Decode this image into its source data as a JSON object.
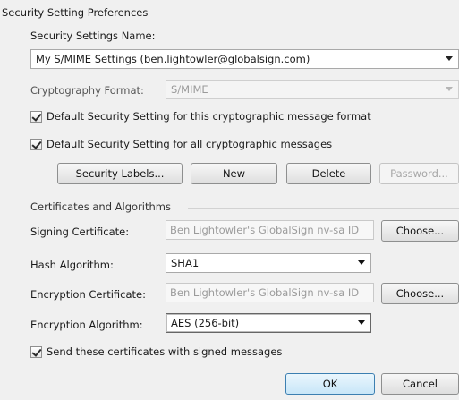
{
  "group_security": {
    "title": "Security Setting Preferences",
    "name_label": "Security Settings Name:",
    "name_value": "My S/MIME Settings (ben.lightowler@globalsign.com)",
    "crypto_format_label": "Cryptography Format:",
    "crypto_format_value": "S/MIME",
    "default_format_checkbox": {
      "label": "Default Security Setting for this cryptographic message format",
      "checked": true
    },
    "default_all_checkbox": {
      "label": "Default Security Setting for all cryptographic messages",
      "checked": true
    },
    "buttons": {
      "security_labels": "Security Labels...",
      "new": "New",
      "delete": "Delete",
      "password": "Password..."
    }
  },
  "group_certs": {
    "title": "Certificates and Algorithms",
    "signing_label": "Signing Certificate:",
    "signing_value": "Ben Lightowler's GlobalSign nv-sa ID",
    "signing_choose": "Choose...",
    "hash_label": "Hash Algorithm:",
    "hash_value": "SHA1",
    "encryption_cert_label": "Encryption Certificate:",
    "encryption_cert_value": "Ben Lightowler's GlobalSign nv-sa ID",
    "encryption_choose": "Choose...",
    "encryption_alg_label": "Encryption Algorithm:",
    "encryption_alg_value": "AES (256-bit)",
    "send_certs_checkbox": {
      "label": "Send these certificates with signed messages",
      "checked": true
    }
  },
  "dialog_buttons": {
    "ok": "OK",
    "cancel": "Cancel"
  }
}
